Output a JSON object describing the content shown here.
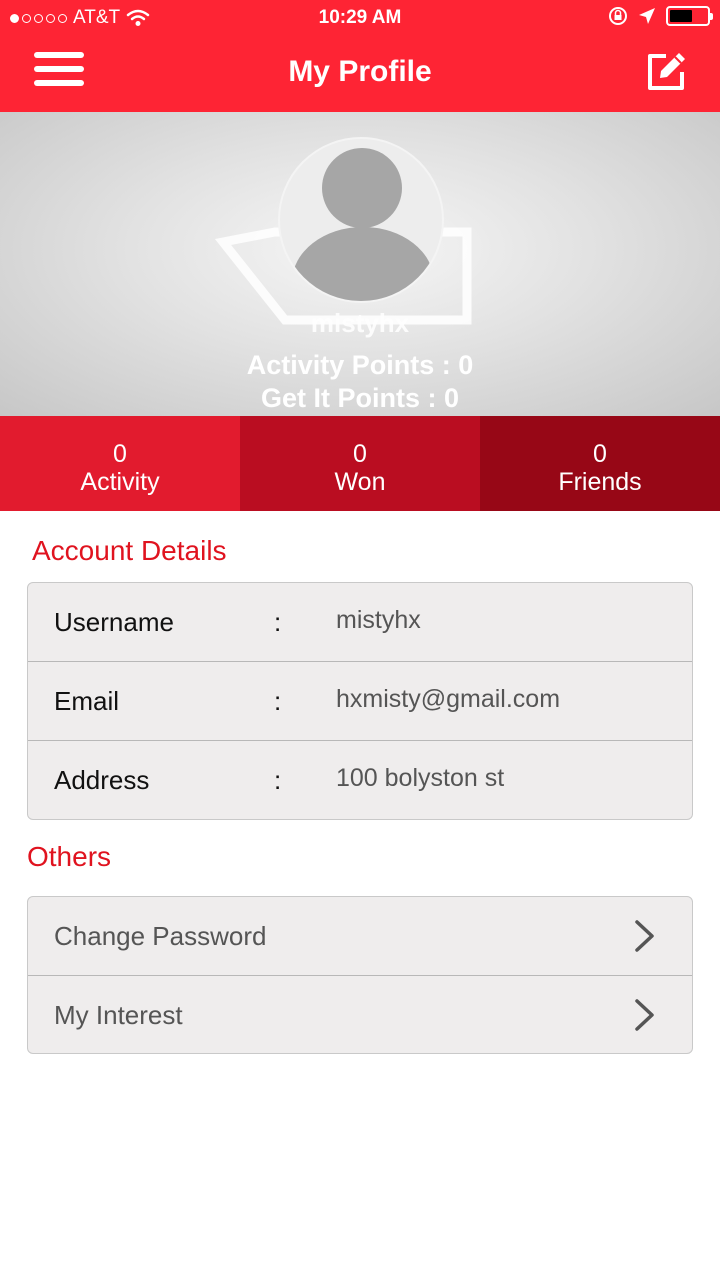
{
  "status_bar": {
    "carrier": "AT&T",
    "time": "10:29 AM",
    "signal_dots_filled": 1,
    "signal_dots_total": 5
  },
  "header": {
    "title": "My Profile",
    "menu_icon": "hamburger-menu-icon",
    "edit_icon": "edit-profile-icon"
  },
  "profile": {
    "username": "mistyhx",
    "activity_points": "Activity Points : 0",
    "get_it_points": "Get It Points : 0"
  },
  "stats": [
    {
      "value": "0",
      "label": "Activity"
    },
    {
      "value": "0",
      "label": "Won"
    },
    {
      "value": "0",
      "label": "Friends"
    }
  ],
  "account": {
    "title": "Account Details",
    "rows": [
      {
        "label": "Username",
        "sep": ":",
        "value": "mistyhx"
      },
      {
        "label": "Email",
        "sep": ":",
        "value": "hxmisty@gmail.com"
      },
      {
        "label": "Address",
        "sep": ":",
        "value": "100 bolyston st"
      }
    ]
  },
  "others": {
    "title": "Others",
    "items": [
      {
        "label": "Change Password"
      },
      {
        "label": "My Interest"
      }
    ]
  },
  "colors": {
    "brand_red": "#fe2434",
    "section_title": "#e0131f",
    "stat_1": "#e21b2e",
    "stat_2": "#ba0d21",
    "stat_3": "#970716"
  }
}
